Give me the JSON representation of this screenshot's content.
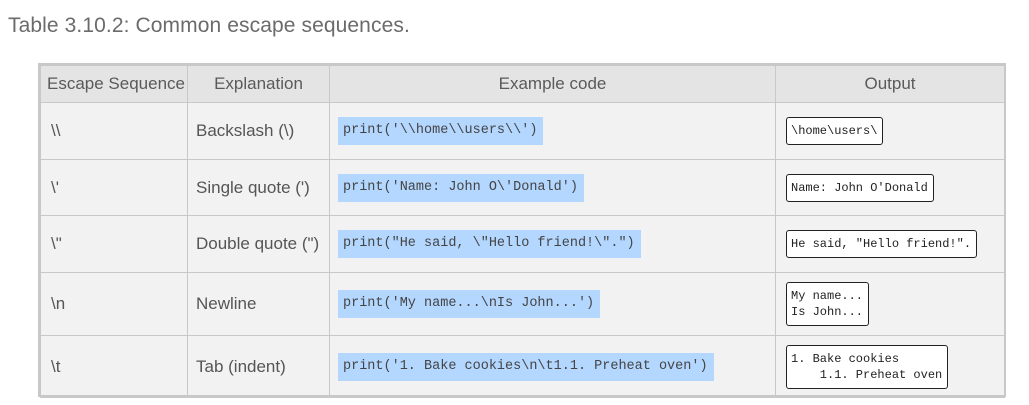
{
  "caption": "Table 3.10.2: Common escape sequences.",
  "headers": {
    "seq": "Escape Sequence",
    "expl": "Explanation",
    "code": "Example code",
    "out": "Output"
  },
  "rows": [
    {
      "seq": "\\\\",
      "expl": "Backslash (\\)",
      "code": "print('\\\\home\\\\users\\\\')",
      "out": "\\home\\users\\"
    },
    {
      "seq": "\\'",
      "expl": "Single quote (')",
      "code": "print('Name: John O\\'Donald')",
      "out": "Name: John O'Donald"
    },
    {
      "seq": "\\\"",
      "expl": "Double quote (\")",
      "code": "print(\"He said, \\\"Hello friend!\\\".\")",
      "out": "He said, \"Hello friend!\"."
    },
    {
      "seq": "\\n",
      "expl": "Newline",
      "code": "print('My name...\\nIs John...')",
      "out": "My name...\nIs John..."
    },
    {
      "seq": "\\t",
      "expl": "Tab (indent)",
      "code": "print('1. Bake cookies\\n\\t1.1. Preheat oven')",
      "out": "1. Bake cookies\n    1.1. Preheat oven"
    }
  ]
}
